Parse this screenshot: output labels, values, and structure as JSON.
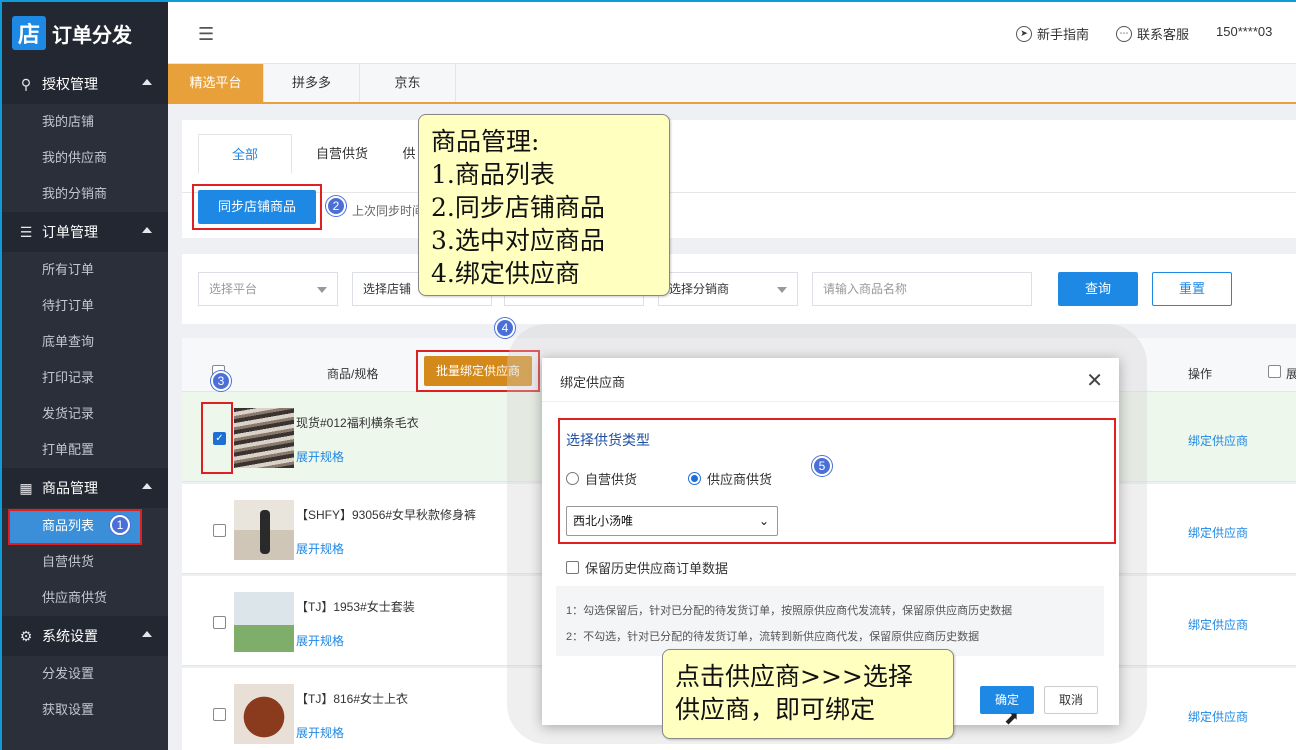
{
  "app": {
    "logo_char": "店",
    "title": "订单分发"
  },
  "sidebar": {
    "groups": [
      {
        "label": "授权管理",
        "icon": "user-key-icon",
        "items": [
          "我的店铺",
          "我的供应商",
          "我的分销商"
        ]
      },
      {
        "label": "订单管理",
        "icon": "order-list-icon",
        "items": [
          "所有订单",
          "待打订单",
          "底单查询",
          "打印记录",
          "发货记录",
          "打单配置"
        ]
      },
      {
        "label": "商品管理",
        "icon": "grid-icon",
        "items": [
          "商品列表",
          "自营供货",
          "供应商供货"
        ]
      },
      {
        "label": "系统设置",
        "icon": "settings-icon",
        "items": [
          "分发设置",
          "获取设置"
        ]
      }
    ],
    "active_item": "商品列表"
  },
  "header": {
    "menu_icon": "☰",
    "guide": "新手指南",
    "service": "联系客服",
    "phone": "150****03"
  },
  "platform_tabs": [
    "精选平台",
    "拼多多",
    "京东"
  ],
  "sub_tabs": [
    "全部",
    "自营供货",
    "供"
  ],
  "sync": {
    "button": "同步店铺商品",
    "last_sync_label": "上次同步时间:"
  },
  "filters": {
    "platform_placeholder": "选择平台",
    "shop_placeholder": "选择店铺",
    "distributor_placeholder": "选择分销商",
    "name_placeholder": "请输入商品名称",
    "query": "查询",
    "reset": "重置"
  },
  "table": {
    "col_product": "商品/规格",
    "col_op": "操作",
    "col_extra": "展",
    "batch_bind": "批量绑定供应商",
    "expand": "展开规格",
    "bind": "绑定供应商",
    "rows": [
      {
        "name": "现货#012福利横条毛衣",
        "checked": true
      },
      {
        "name": "【SHFY】93056#女早秋款修身裤",
        "checked": false
      },
      {
        "name": "【TJ】1953#女士套装",
        "checked": false
      },
      {
        "name": "【TJ】816#女士上衣",
        "checked": false
      }
    ]
  },
  "modal": {
    "title": "绑定供应商",
    "section_title": "选择供货类型",
    "option_self": "自营供货",
    "option_supplier": "供应商供货",
    "selected_supplier": "西北小汤唯",
    "keep_history": "保留历史供应商订单数据",
    "note1": "1：勾选保留后，针对已分配的待发货订单，按照原供应商代发流转，保留原供应商历史数据",
    "note2": "2：不勾选，针对已分配的待发货订单，流转到新供应商代发，保留原供应商历史数据",
    "confirm": "确定",
    "cancel": "取消"
  },
  "callouts": {
    "main_lines": [
      "商品管理:",
      "1.商品列表",
      "2.同步店铺商品",
      "3.选中对应商品",
      "4.绑定供应商"
    ],
    "bottom_lines": [
      "点击供应商>>>选择",
      "供应商，即可绑定"
    ]
  },
  "badges": [
    "1",
    "2",
    "3",
    "4",
    "5"
  ]
}
